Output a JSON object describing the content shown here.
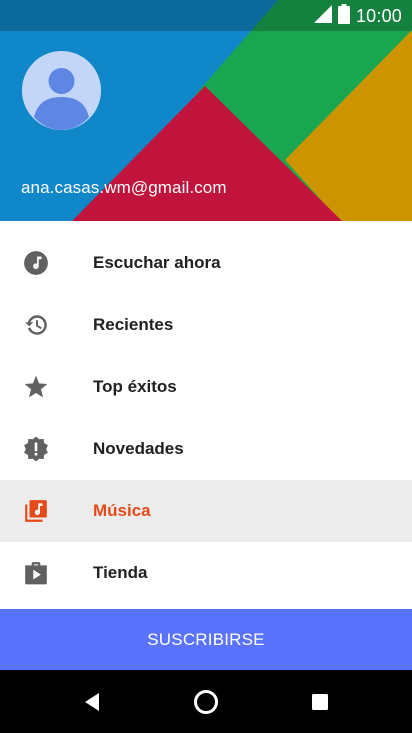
{
  "status_bar": {
    "time": "10:00",
    "icons": [
      "signal-icon",
      "battery-icon"
    ]
  },
  "header": {
    "email": "ana.casas.wm@gmail.com",
    "colors": {
      "blue": "#0f87c8",
      "red": "#c0143c",
      "green": "#1aa651",
      "yellow": "#cc9500",
      "avatar_bg": "#c3d6f7",
      "avatar_person": "#5d87e3"
    }
  },
  "menu": {
    "items": [
      {
        "label": "Escuchar ahora",
        "icon": "music-note-icon",
        "selected": false
      },
      {
        "label": "Recientes",
        "icon": "history-icon",
        "selected": false
      },
      {
        "label": "Top éxitos",
        "icon": "star-icon",
        "selected": false
      },
      {
        "label": "Novedades",
        "icon": "new-releases-icon",
        "selected": false
      },
      {
        "label": "Música",
        "icon": "music-library-icon",
        "selected": true
      },
      {
        "label": "Tienda",
        "icon": "shop-icon",
        "selected": false
      }
    ],
    "selected_color": "#e64a19",
    "icon_color": "#616161"
  },
  "subscribe": {
    "label": "SUSCRIBIRSE",
    "color": "#5a73ff"
  },
  "nav_bar": {
    "buttons": [
      "back-icon",
      "home-icon",
      "recents-icon"
    ]
  }
}
